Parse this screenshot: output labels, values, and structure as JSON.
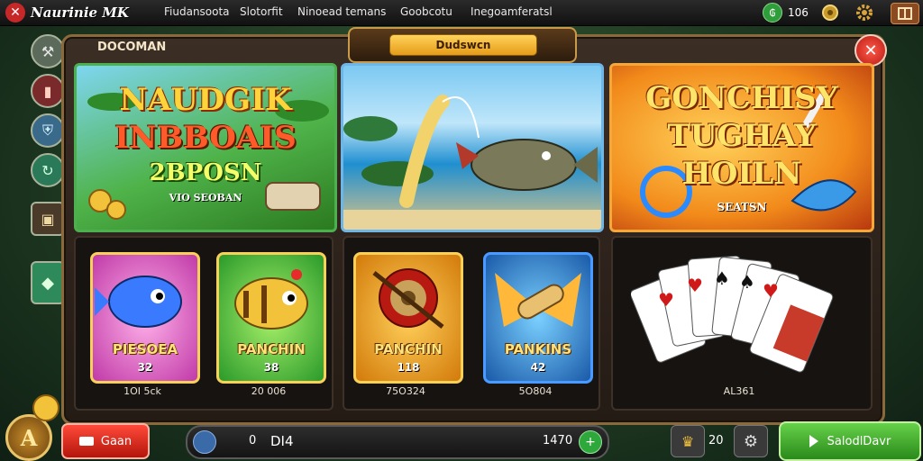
{
  "header": {
    "logo_text": "Naurinie MK",
    "nav": [
      "Fiudansoota",
      "Slotorfit",
      "Ninoead temans",
      "Goobcotu",
      "Inegoamferatsl"
    ],
    "coins_value": "106"
  },
  "panel": {
    "title": "DOCOMAN",
    "banner_label": "Dudswcn"
  },
  "features": [
    {
      "title_lines": [
        "NAUDGIK",
        "INBBOAIS"
      ],
      "subtitle": "2BPOSN",
      "tag": "VIO SEOBAN"
    },
    {
      "title_lines": []
    },
    {
      "title_lines": [
        "GONCHISY",
        "TUGHAY",
        "HOILN"
      ],
      "tag": "SEATSN"
    }
  ],
  "tiles": [
    {
      "name": "PIESOEA",
      "number": "32",
      "caption": "1OI 5ck"
    },
    {
      "name": "PANCHIN",
      "number": "38",
      "caption": "20 006"
    },
    {
      "name": "PANCHIN",
      "number": "118",
      "caption": "75O324"
    },
    {
      "name": "PANKINS",
      "number": "42",
      "caption": "5O804"
    }
  ],
  "cards": {
    "caption": "AL361"
  },
  "footer": {
    "left_button": "Gaan",
    "mid_left_num": "0",
    "mid_label": "DI4",
    "mid_right_num": "1470",
    "count": "20",
    "right_button": "SalodlDavr"
  },
  "colors": {
    "accent_green": "#2e9d3a",
    "accent_red": "#c62828",
    "gold": "#f6c43a"
  }
}
